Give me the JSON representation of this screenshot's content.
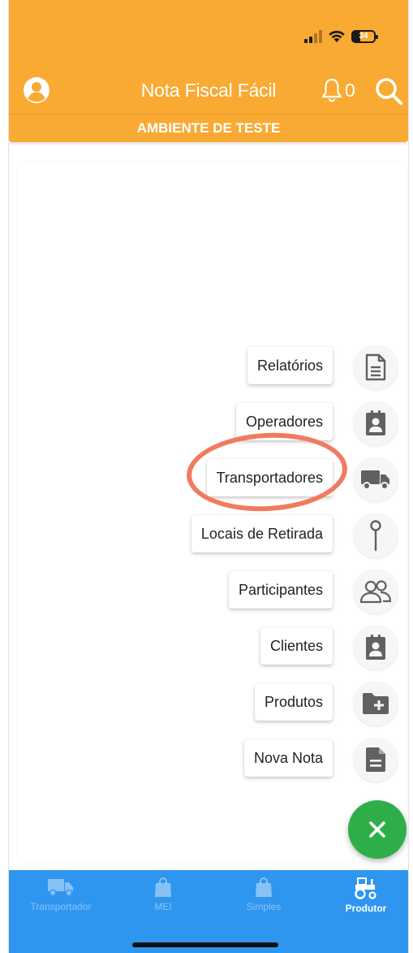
{
  "status_bar": {
    "battery_level": "34",
    "icons": [
      "signal-icon",
      "wifi-icon",
      "battery-icon"
    ]
  },
  "header": {
    "title": "Nota Fiscal Fácil",
    "notification_count": "0",
    "icons": [
      "account-circle-icon",
      "bell-icon",
      "search-icon"
    ]
  },
  "environment_banner": "AMBIENTE DE TESTE",
  "fab_menu": {
    "items": [
      {
        "label": "Relatórios",
        "icon": "document-lines-icon"
      },
      {
        "label": "Operadores",
        "icon": "badge-icon"
      },
      {
        "label": "Transportadores",
        "icon": "truck-icon"
      },
      {
        "label": "Locais de Retirada",
        "icon": "pin-icon"
      },
      {
        "label": "Participantes",
        "icon": "people-icon"
      },
      {
        "label": "Clientes",
        "icon": "badge-icon"
      },
      {
        "label": "Produtos",
        "icon": "folder-plus-icon"
      },
      {
        "label": "Nova Nota",
        "icon": "document-icon"
      }
    ],
    "close_icon": "close-icon",
    "close_color": "#2eae49"
  },
  "bottom_nav": {
    "items": [
      {
        "label": "Transportador",
        "icon": "truck-icon",
        "active": false
      },
      {
        "label": "MEI",
        "icon": "shopping-bag-icon",
        "active": false
      },
      {
        "label": "Simples",
        "icon": "shopping-bag-icon",
        "active": false
      },
      {
        "label": "Produtor",
        "icon": "tractor-icon",
        "active": true
      }
    ]
  },
  "colors": {
    "header": "#f9aa33",
    "bottom_nav": "#2f96f0",
    "fab": "#2eae49",
    "highlight": "#f07b60"
  }
}
